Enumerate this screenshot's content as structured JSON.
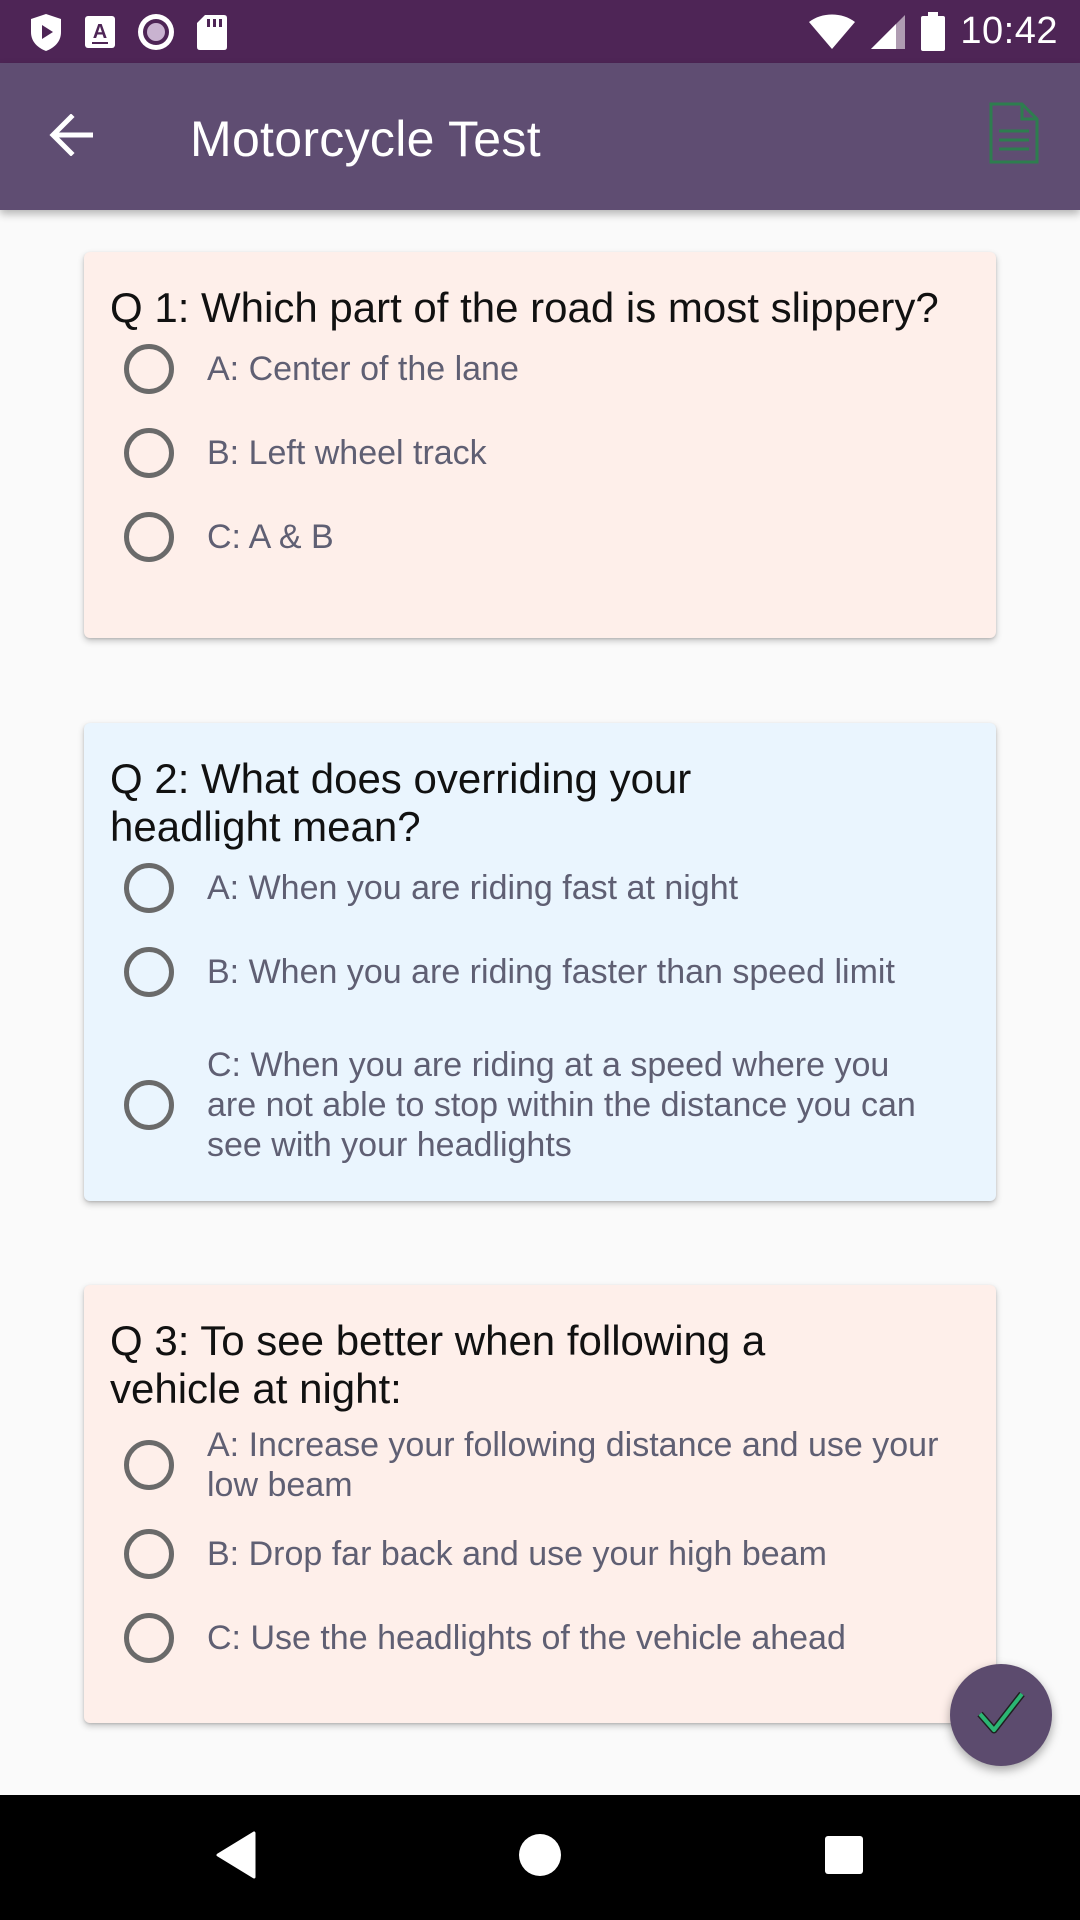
{
  "status_bar": {
    "time": "10:42",
    "left_icons": [
      "play-protect-icon",
      "font-a-icon",
      "record-icon",
      "sd-card-icon"
    ],
    "right_icons": [
      "wifi-icon",
      "signal-icon",
      "battery-icon"
    ]
  },
  "app_bar": {
    "title": "Motorcycle Test",
    "back_icon": "arrow-back-icon",
    "action_icon": "document-icon",
    "action_icon_color": "#2e7d4f"
  },
  "questions": [
    {
      "text": "Q 1: Which part of the road is most slippery?",
      "background": "#feefea",
      "options": [
        "A: Center of the lane",
        "B: Left wheel track",
        "C: A & B"
      ]
    },
    {
      "text": "Q 2: What does overriding your headlight mean?",
      "background": "#eaf5fe",
      "options": [
        "A: When you are riding fast at night",
        "B: When you are riding faster than speed limit",
        "C: When you are riding at a speed where you are not able to stop within the distance you can see with your headlights"
      ]
    },
    {
      "text": "Q 3: To see better when following a vehicle at night:",
      "background": "#feefea",
      "options": [
        "A: Increase your following distance and use your low beam",
        "B: Drop far back and use your high beam",
        "C: Use the headlights of the vehicle ahead"
      ]
    }
  ],
  "fab": {
    "icon": "check-icon",
    "color": "#5c4b6e",
    "icon_color": "#2bb673"
  },
  "nav_bar": {
    "icons": [
      "back-triangle-icon",
      "home-circle-icon",
      "recents-square-icon"
    ]
  },
  "colors": {
    "status_bar": "#4e2556",
    "app_bar": "#5f4d72",
    "question_text": "#111111",
    "option_text": "#5f5f73"
  }
}
